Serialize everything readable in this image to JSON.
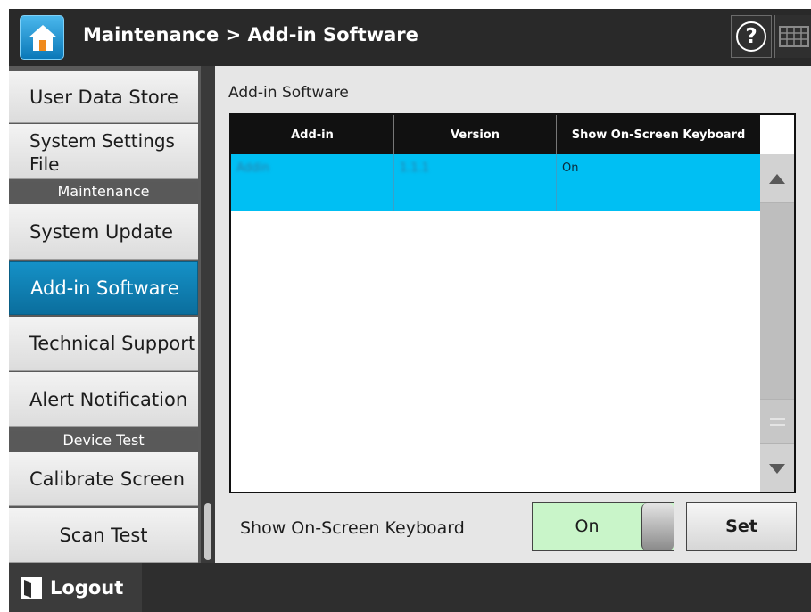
{
  "header": {
    "title": "Maintenance > Add-in Software",
    "home_icon": "home-icon",
    "help_glyph": "?",
    "keyboard_icon": "keyboard-icon"
  },
  "sidebar": {
    "items": [
      {
        "label": "User Data Store"
      },
      {
        "label": "System Settings File"
      },
      {
        "label": "System Update"
      },
      {
        "label": "Add-in Software",
        "active": true
      },
      {
        "label": "Technical Support"
      },
      {
        "label": "Alert Notification"
      },
      {
        "label": "Calibrate Screen"
      },
      {
        "label": "Scan Test"
      }
    ],
    "sections": [
      "Maintenance",
      "Device Test"
    ]
  },
  "main": {
    "title": "Add-in Software",
    "table": {
      "columns": [
        "Add-in",
        "Version",
        "Show On-Screen Keyboard"
      ],
      "rows": [
        {
          "addin": "Addin",
          "version": "1.1.1",
          "keyboard": "On",
          "selected": true
        }
      ]
    },
    "keyboard_setting": {
      "label": "Show On-Screen Keyboard",
      "value": "On"
    },
    "set_label": "Set"
  },
  "footer": {
    "logout_label": "Logout"
  },
  "colors": {
    "selected_row": "#00bff3",
    "active_nav": "#1591c7",
    "toggle_on": "#c9f5c9",
    "header_bg": "#292929"
  }
}
